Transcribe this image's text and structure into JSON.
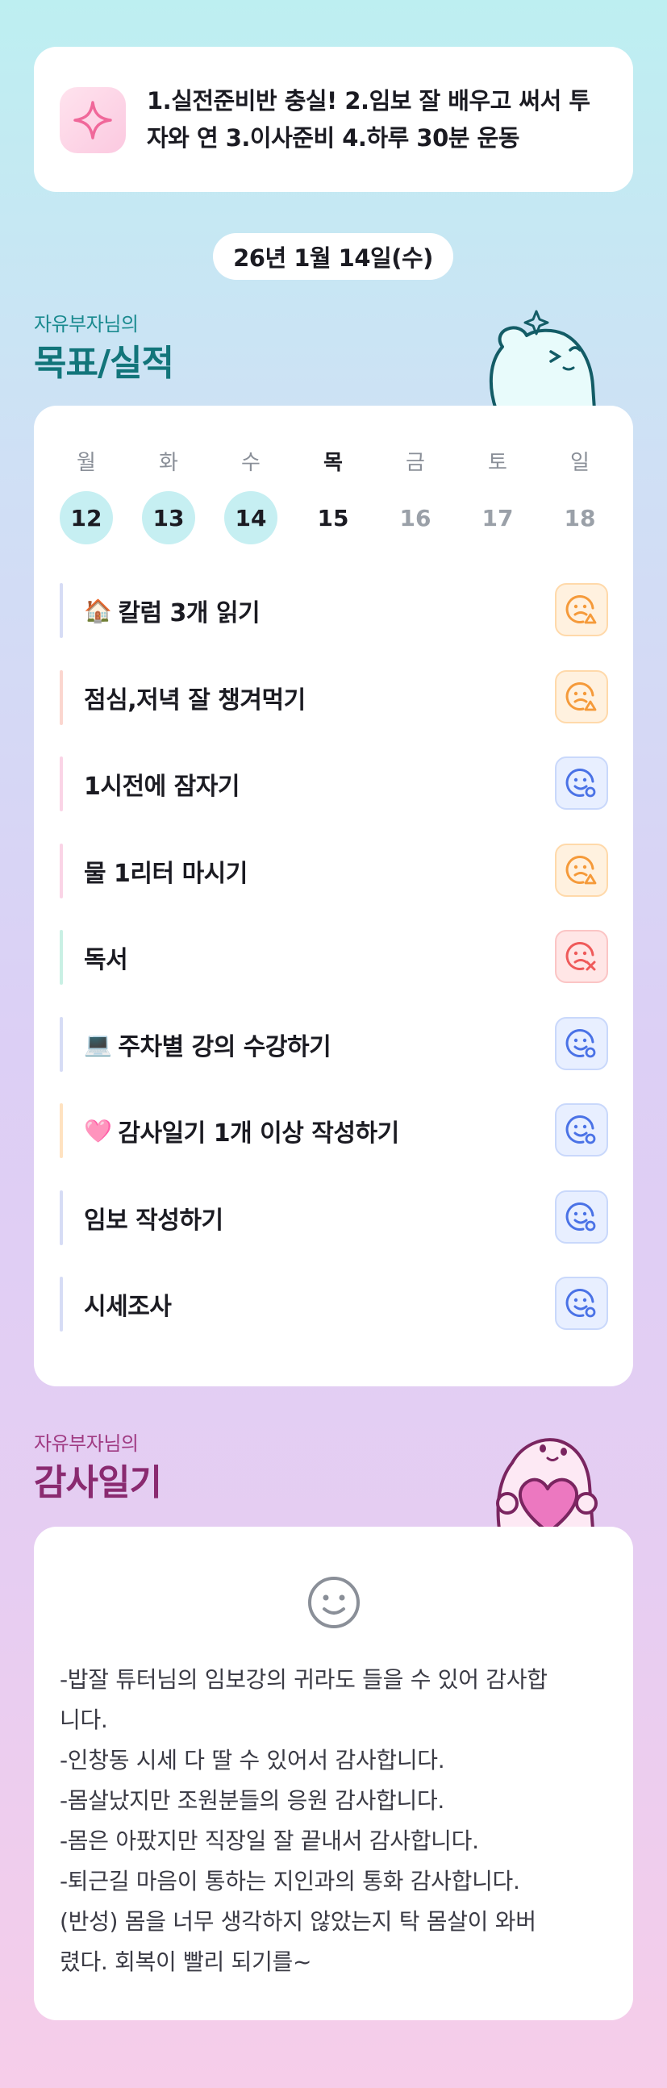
{
  "goal_banner": {
    "icon": "sparkle-icon",
    "line1": "1.실전준비반 충실! 2.임보 잘 배우고 써서 투",
    "line2": "자와 연 3.이사준비 4.하루 30분 운동"
  },
  "date": "26년 1월 14일(수)",
  "goals_section": {
    "subtitle": "자유부자님의",
    "title": "목표/실적",
    "weekdays": [
      "월",
      "화",
      "수",
      "목",
      "금",
      "토",
      "일"
    ],
    "days": [
      "12",
      "13",
      "14",
      "15",
      "16",
      "17",
      "18"
    ],
    "tasks": [
      {
        "emoji": "🏠",
        "label": "칼럼 3개 읽기",
        "status": "triangle",
        "bar": "#d6dcf5"
      },
      {
        "emoji": "",
        "label": "점심,저녁 잘 챙겨먹기",
        "status": "triangle",
        "bar": "#fbd6cf"
      },
      {
        "emoji": "",
        "label": "1시전에 잠자기",
        "status": "circle",
        "bar": "#fad4e6"
      },
      {
        "emoji": "",
        "label": "물 1리터 마시기",
        "status": "triangle",
        "bar": "#fad4e6"
      },
      {
        "emoji": "",
        "label": "독서",
        "status": "x",
        "bar": "#c9f0e4"
      },
      {
        "emoji": "💻",
        "label": "주차별 강의 수강하기",
        "status": "circle",
        "bar": "#d6dcf5"
      },
      {
        "emoji": "🩷",
        "label": "감사일기 1개 이상 작성하기",
        "status": "circle",
        "bar": "#ffe2c0"
      },
      {
        "emoji": "",
        "label": "임보 작성하기",
        "status": "circle",
        "bar": "#d6dcf5"
      },
      {
        "emoji": "",
        "label": "시세조사",
        "status": "circle",
        "bar": "#d6dcf5"
      }
    ]
  },
  "diary_section": {
    "subtitle": "자유부자님의",
    "title": "감사일기",
    "icon": "smile-icon",
    "lines": [
      "-밥잘 튜터님의 임보강의 귀라도 들을 수 있어 감사합",
      "니다.",
      "-인창동 시세 다 딸 수 있어서 감사합니다.",
      "-몸살났지만 조원분들의 응원 감사합니다.",
      "-몸은 아팠지만 직장일 잘 끝내서 감사합니다.",
      "-퇴근길 마음이 통하는 지인과의 통화 감사합니다.",
      "(반성) 몸을 너무 생각하지 않았는지 탁 몸살이 와버",
      "렸다. 회복이 빨리 되기를~"
    ]
  },
  "colors": {
    "warn": "#f59a3a",
    "good": "#4a72e6",
    "bad": "#ef5a5a",
    "teal": "#1a8a8f",
    "purple": "#a03b83"
  }
}
